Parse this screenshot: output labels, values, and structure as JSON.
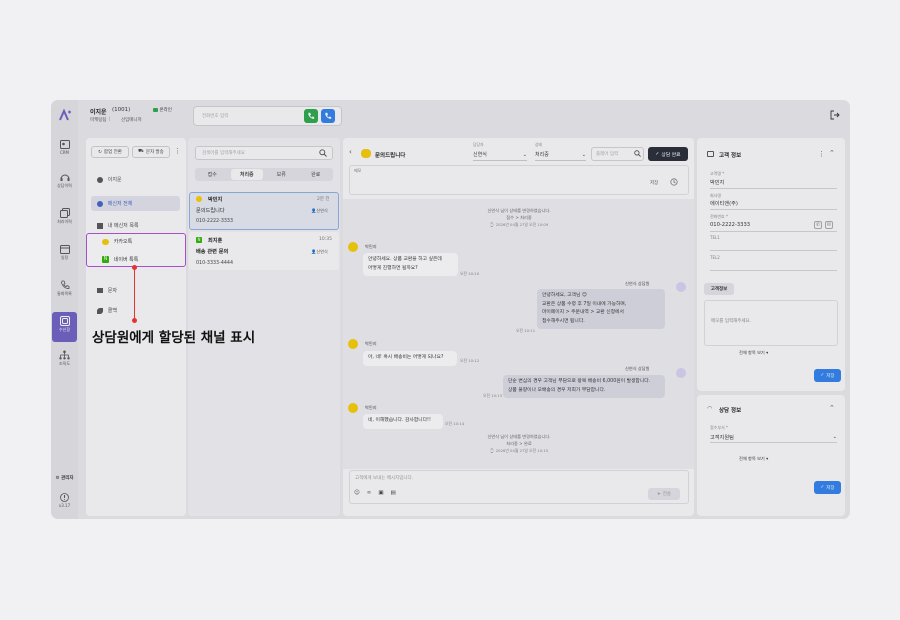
{
  "user": {
    "name": "이지운",
    "ext": "(1001)",
    "status": "온라인",
    "team": "마케팅팀",
    "role": "선임매니저"
  },
  "search": {
    "placeholder": "전화번호 입력"
  },
  "rail": [
    {
      "label": "CRM"
    },
    {
      "label": "상담이력"
    },
    {
      "label": "처리이력"
    },
    {
      "label": "일정"
    },
    {
      "label": "통화목록"
    },
    {
      "label": "수신함"
    },
    {
      "label": "조직도"
    }
  ],
  "rail_bottom": {
    "admin": "관리자",
    "version": "v3.17"
  },
  "channel_panel": {
    "switch_btn": "합업 전환",
    "sms_btn": "문자 발송",
    "user": "이지운",
    "all": "메신저 전체",
    "mine": "내 메신저 목록",
    "kakao": "카카오톡",
    "naver": "네이버 톡톡",
    "sms": "문자",
    "call": "콜백"
  },
  "list_panel": {
    "search_placeholder": "검색어를 입력해주세요",
    "tabs": [
      "접수",
      "처리중",
      "보류",
      "완료"
    ],
    "items": [
      {
        "name": "박민지",
        "time": "2분 전",
        "title": "문의드립니다",
        "agent": "신연식",
        "phone": "010-2222-3333"
      },
      {
        "name": "최지훈",
        "time": "10:35",
        "title": "배송 관련 문의",
        "agent": "신연식",
        "phone": "010-3333-4444"
      }
    ]
  },
  "chat": {
    "title": "문의드립니다",
    "assignee_label": "담당자",
    "assignee": "신연식",
    "status_label": "상태",
    "status": "처리중",
    "memo_search": "플레어 입력",
    "done_btn": "상담 완료",
    "memo_label": "메모",
    "save": "저장",
    "sys1": [
      "신연식 님이 상태를 변경하였습니다.",
      "접수 > 처리중",
      "2026년 04월 27일 오전 10:09"
    ],
    "m1_name": "박민지",
    "m1": [
      "안녕하세요. 상품 교환을 하고 싶은데",
      "어떻게 진행하면 될까요?"
    ],
    "m1_time": "오전 10:10",
    "a1_name": "신연식 상담원",
    "a1": [
      "안녕하세요, 고객님 😊",
      "교환은 상품 수령 후 7일 이내에 가능하며,",
      "마이페이지 > 주문내역 > 교환 신청에서",
      "접수해주시면 됩니다."
    ],
    "a1_time": "오전 10:11",
    "m2_name": "박민지",
    "m2": [
      "아, 네! 혹시 배송비는 어떻게 되나요?"
    ],
    "m2_time": "오전 10:12",
    "a2_name": "신연식 상담원",
    "a2": [
      "단순 변심의 경우 고객님 부담으로 왕복 배송비 6,000원이 발생합니다.",
      "상품 불량이나 오배송의 경우 저희가 부담합니다."
    ],
    "a2_time": "오전 10:13",
    "m3_name": "박민지",
    "m3": [
      "네, 이해했습니다. 감사합니다!!"
    ],
    "m3_time": "오전 10:14",
    "sys2": [
      "신연식 님이 상태를 변경하였습니다.",
      "처리중 > 완료",
      "2026년 04월 27일 오전 10:15"
    ],
    "input_placeholder": "고객에게 보내는 메시지입니다.",
    "send": "전송"
  },
  "customer": {
    "title": "고객 정보",
    "name_label": "고객명 *",
    "name": "박민지",
    "company_label": "회사명",
    "company": "에이티엔(주)",
    "phone_label": "전화번호 *",
    "phone": "010-2222-3333",
    "tel1": "TEL1",
    "tel2": "TEL2",
    "memo_title": "고객정보",
    "memo_placeholder": "메모를 입력해주세요.",
    "more": "전체 항목 보기",
    "save": "저장"
  },
  "consult": {
    "title": "상담 정보",
    "dept_label": "접수부서 *",
    "dept": "고객지원팀",
    "more": "전체 항목 보기",
    "save": "저장"
  },
  "annotation": "상담원에게 할당된 채널 표시",
  "colors": {
    "accent": "#6d5fc2",
    "kakao": "#f6cc00",
    "naver": "#2db400",
    "green": "#2aa84a",
    "blue": "#2f80ed",
    "highlight": "#b04fd6",
    "annotation": "#e3342f"
  }
}
